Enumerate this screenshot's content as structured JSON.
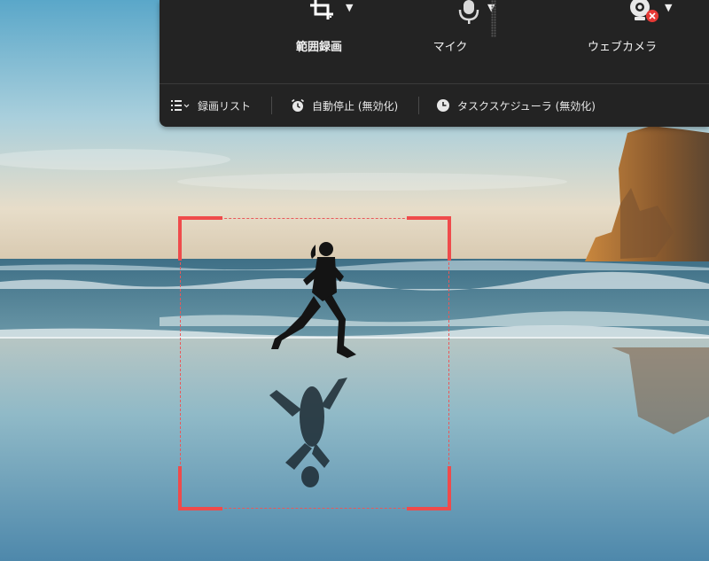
{
  "toolbar": {
    "sources": {
      "region_label": "範囲録画",
      "mic_label": "マイク",
      "webcam_label": "ウェブカメラ"
    },
    "icons": {
      "region": "crop-icon",
      "mic": "microphone-icon",
      "webcam": "webcam-icon",
      "webcam_status": "disabled-badge-icon"
    },
    "bottom": {
      "recording_list": "録画リスト",
      "auto_stop": "自動停止 (無効化)",
      "task_scheduler": "タスクスケジューラ (無効化)"
    }
  },
  "colors": {
    "panel_bg": "#232323",
    "capture_frame": "#ef4b4b",
    "disabled_badge": "#e53935"
  }
}
